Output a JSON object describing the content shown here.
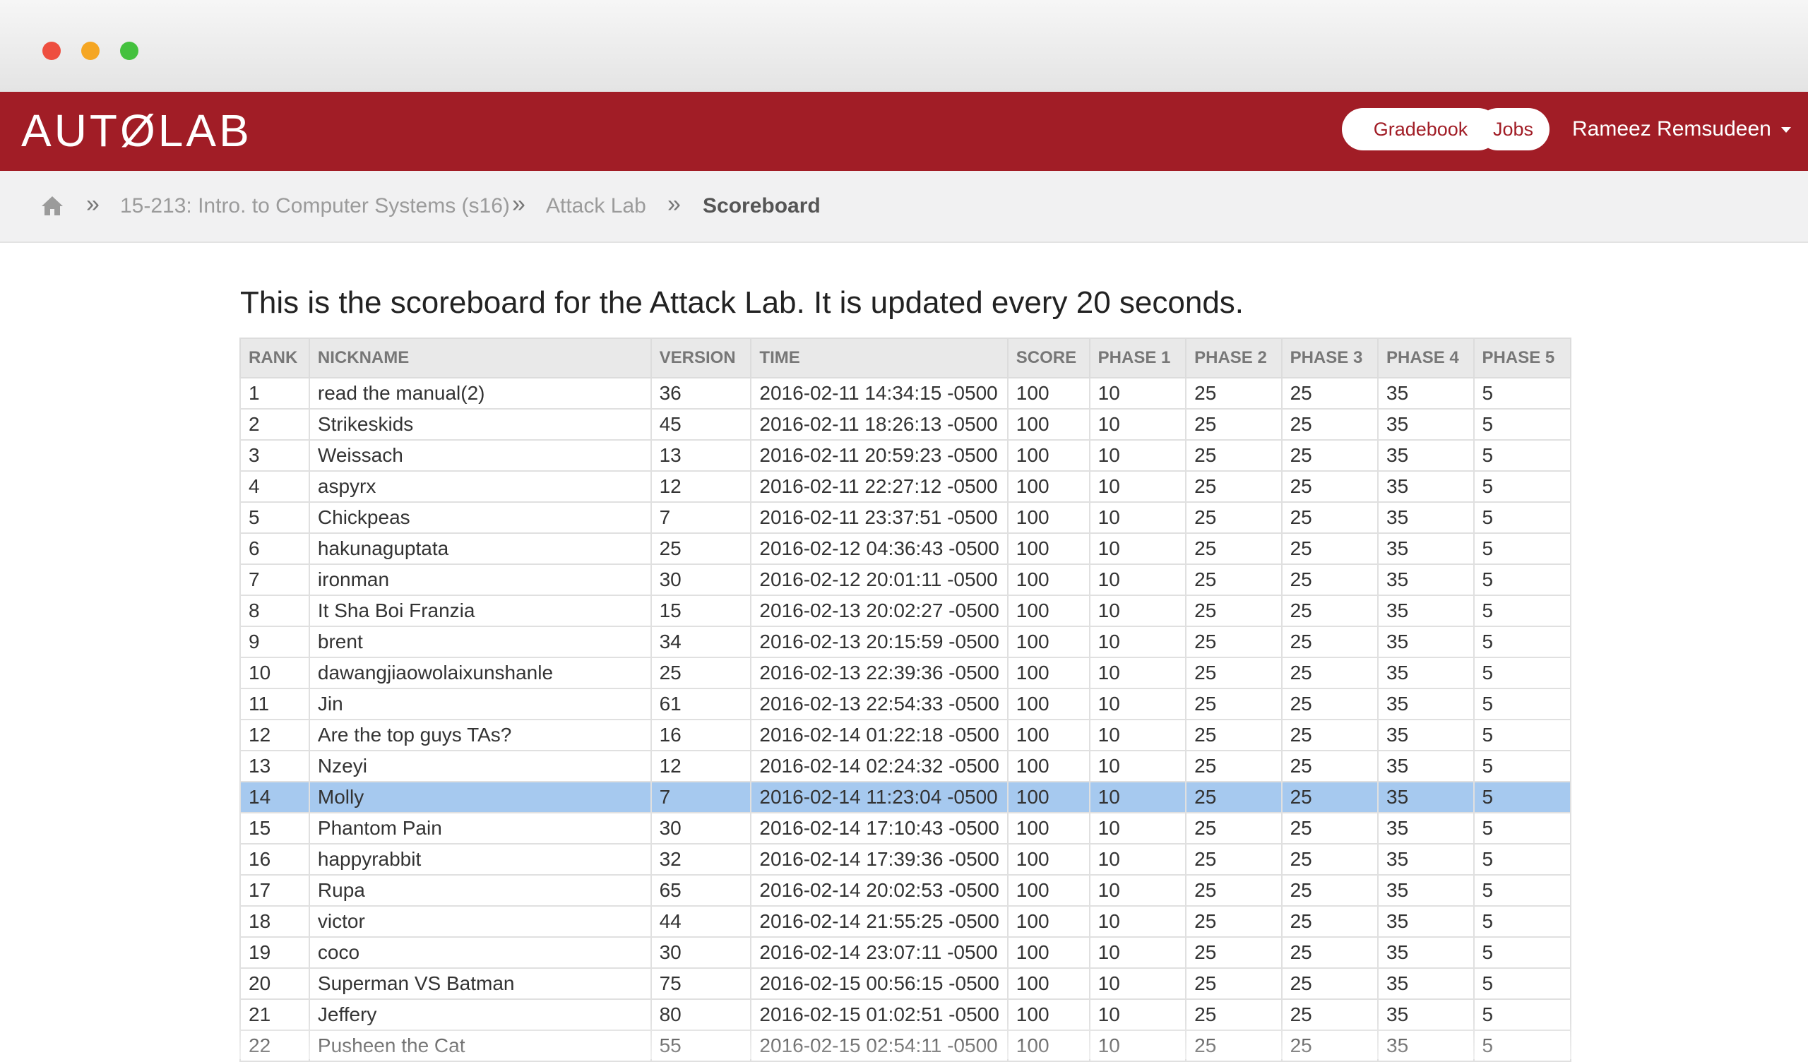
{
  "window": {
    "title": ""
  },
  "navbar": {
    "logo": "AUTØLAB",
    "gradebook_label": "Gradebook",
    "jobs_label": "Jobs",
    "user_name": "Rameez Remsudeen",
    "brand_color": "#a11d26"
  },
  "breadcrumb": {
    "sep": "»",
    "course": "15-213: Intro. to Computer Systems (s16)",
    "assessment": "Attack Lab",
    "current": "Scoreboard"
  },
  "main": {
    "intro": "This is the scoreboard for the Attack Lab. It is updated every 20 seconds."
  },
  "table": {
    "headers": [
      "RANK",
      "NICKNAME",
      "VERSION",
      "TIME",
      "SCORE",
      "PHASE 1",
      "PHASE 2",
      "PHASE 3",
      "PHASE 4",
      "PHASE 5"
    ],
    "highlight_rank": "14",
    "highlight_color": "#a6c9ef",
    "rows": [
      [
        "1",
        "read the manual(2)",
        "36",
        "2016-02-11 14:34:15 -0500",
        "100",
        "10",
        "25",
        "25",
        "35",
        "5"
      ],
      [
        "2",
        "Strikeskids",
        "45",
        "2016-02-11 18:26:13 -0500",
        "100",
        "10",
        "25",
        "25",
        "35",
        "5"
      ],
      [
        "3",
        "Weissach",
        "13",
        "2016-02-11 20:59:23 -0500",
        "100",
        "10",
        "25",
        "25",
        "35",
        "5"
      ],
      [
        "4",
        "aspyrx",
        "12",
        "2016-02-11 22:27:12 -0500",
        "100",
        "10",
        "25",
        "25",
        "35",
        "5"
      ],
      [
        "5",
        "Chickpeas",
        "7",
        "2016-02-11 23:37:51 -0500",
        "100",
        "10",
        "25",
        "25",
        "35",
        "5"
      ],
      [
        "6",
        "hakunaguptata",
        "25",
        "2016-02-12 04:36:43 -0500",
        "100",
        "10",
        "25",
        "25",
        "35",
        "5"
      ],
      [
        "7",
        "ironman",
        "30",
        "2016-02-12 20:01:11 -0500",
        "100",
        "10",
        "25",
        "25",
        "35",
        "5"
      ],
      [
        "8",
        "It Sha Boi Franzia",
        "15",
        "2016-02-13 20:02:27 -0500",
        "100",
        "10",
        "25",
        "25",
        "35",
        "5"
      ],
      [
        "9",
        "brent",
        "34",
        "2016-02-13 20:15:59 -0500",
        "100",
        "10",
        "25",
        "25",
        "35",
        "5"
      ],
      [
        "10",
        "dawangjiaowolaixunshanle",
        "25",
        "2016-02-13 22:39:36 -0500",
        "100",
        "10",
        "25",
        "25",
        "35",
        "5"
      ],
      [
        "11",
        "Jin",
        "61",
        "2016-02-13 22:54:33 -0500",
        "100",
        "10",
        "25",
        "25",
        "35",
        "5"
      ],
      [
        "12",
        "Are the top guys TAs?",
        "16",
        "2016-02-14 01:22:18 -0500",
        "100",
        "10",
        "25",
        "25",
        "35",
        "5"
      ],
      [
        "13",
        "Nzeyi",
        "12",
        "2016-02-14 02:24:32 -0500",
        "100",
        "10",
        "25",
        "25",
        "35",
        "5"
      ],
      [
        "14",
        "Molly",
        "7",
        "2016-02-14 11:23:04 -0500",
        "100",
        "10",
        "25",
        "25",
        "35",
        "5"
      ],
      [
        "15",
        "Phantom Pain",
        "30",
        "2016-02-14 17:10:43 -0500",
        "100",
        "10",
        "25",
        "25",
        "35",
        "5"
      ],
      [
        "16",
        "happyrabbit",
        "32",
        "2016-02-14 17:39:36 -0500",
        "100",
        "10",
        "25",
        "25",
        "35",
        "5"
      ],
      [
        "17",
        "Rupa",
        "65",
        "2016-02-14 20:02:53 -0500",
        "100",
        "10",
        "25",
        "25",
        "35",
        "5"
      ],
      [
        "18",
        "victor",
        "44",
        "2016-02-14 21:55:25 -0500",
        "100",
        "10",
        "25",
        "25",
        "35",
        "5"
      ],
      [
        "19",
        "coco",
        "30",
        "2016-02-14 23:07:11 -0500",
        "100",
        "10",
        "25",
        "25",
        "35",
        "5"
      ],
      [
        "20",
        "Superman VS Batman",
        "75",
        "2016-02-15 00:56:15 -0500",
        "100",
        "10",
        "25",
        "25",
        "35",
        "5"
      ],
      [
        "21",
        "Jeffery",
        "80",
        "2016-02-15 01:02:51 -0500",
        "100",
        "10",
        "25",
        "25",
        "35",
        "5"
      ],
      [
        "22",
        "Pusheen the Cat",
        "55",
        "2016-02-15 02:54:11 -0500",
        "100",
        "10",
        "25",
        "25",
        "35",
        "5"
      ]
    ]
  }
}
